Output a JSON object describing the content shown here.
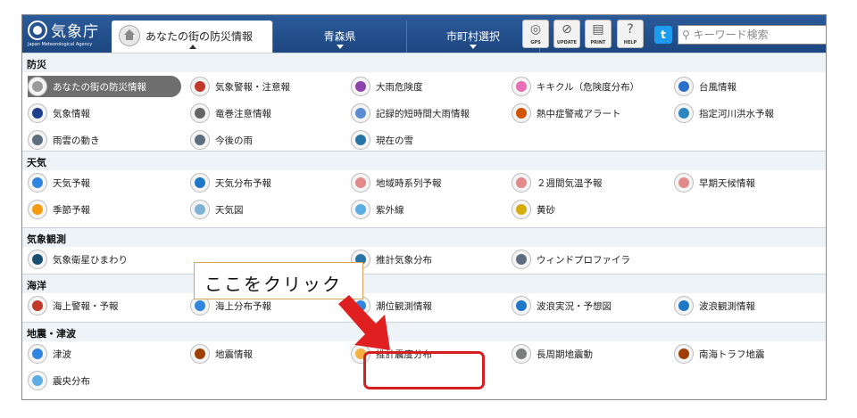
{
  "header": {
    "logo_text": "気象庁",
    "logo_sub": "Japan Meteorological Agency",
    "active_tab": "あなたの街の防災情報",
    "home_icon": "home-icon",
    "tabs": [
      "青森県",
      "市町村選択"
    ],
    "tools": [
      {
        "name": "gps",
        "caption": "GPS",
        "glyph": "◎"
      },
      {
        "name": "updates",
        "caption": "UPDATE",
        "glyph": "⊘"
      },
      {
        "name": "print",
        "caption": "PRINT",
        "glyph": "▤"
      },
      {
        "name": "help",
        "caption": "HELP",
        "glyph": "?"
      }
    ],
    "twitter_glyph": "t",
    "search_placeholder": "キーワード検索",
    "header_color": "#2c5b9a"
  },
  "sections": [
    {
      "title": "防災",
      "items": [
        {
          "label": "あなたの街の防災情報",
          "icon": "home-icon",
          "selected": true,
          "color": "#9a9a9a"
        },
        {
          "label": "気象警報・注意報",
          "icon": "warning-icon",
          "color": "#c0392b"
        },
        {
          "label": "大雨危険度",
          "icon": "heavy-rain-risk-icon",
          "color": "#8e44ad"
        },
        {
          "label": "キキクル（危険度分布）",
          "icon": "kikikuru-icon",
          "color": "#e86fb7"
        },
        {
          "label": "台風情報",
          "icon": "typhoon-icon",
          "color": "#2a6fc9"
        },
        {
          "label": "気象情報",
          "icon": "weather-info-icon",
          "color": "#1e3f8a"
        },
        {
          "label": "竜巻注意情報",
          "icon": "tornado-icon",
          "color": "#666666"
        },
        {
          "label": "記録的短時間大雨情報",
          "icon": "record-rain-icon",
          "color": "#5b8bd0"
        },
        {
          "label": "熱中症警戒アラート",
          "icon": "heatstroke-icon",
          "color": "#d35400"
        },
        {
          "label": "指定河川洪水予報",
          "icon": "river-flood-icon",
          "color": "#2e86c1"
        },
        {
          "label": "雨雲の動き",
          "icon": "rain-cloud-icon",
          "color": "#5d6d7e"
        },
        {
          "label": "今後の雨",
          "icon": "future-rain-icon",
          "color": "#5d6d7e"
        },
        {
          "label": "現在の雪",
          "icon": "snow-icon",
          "color": "#2874a6"
        }
      ]
    },
    {
      "title": "天気",
      "items": [
        {
          "label": "天気予報",
          "icon": "forecast-icon",
          "color": "#2e86de"
        },
        {
          "label": "天気分布予報",
          "icon": "weather-distribution-icon",
          "color": "#1f77c8"
        },
        {
          "label": "地域時系列予報",
          "icon": "regional-timeseries-icon",
          "color": "#e08a8a"
        },
        {
          "label": "２週間気温予報",
          "icon": "two-week-temp-icon",
          "color": "#e08a8a"
        },
        {
          "label": "早期天候情報",
          "icon": "early-weather-icon",
          "color": "#e08a8a"
        },
        {
          "label": "季節予報",
          "icon": "seasonal-icon",
          "color": "#f39c12"
        },
        {
          "label": "天気図",
          "icon": "weather-map-icon",
          "color": "#7fb3d5"
        },
        {
          "label": "紫外線",
          "icon": "uv-icon",
          "color": "#5dade2"
        },
        {
          "label": "黄砂",
          "icon": "yellow-sand-icon",
          "color": "#d4ac0d"
        }
      ]
    },
    {
      "title": "気象観測",
      "items": [
        {
          "label": "気象衛星ひまわり",
          "icon": "satellite-icon",
          "color": "#1b4f72"
        },
        {
          "label": "推計気象分布",
          "icon": "estimated-weather-icon",
          "color": "#2874a6"
        },
        {
          "label": "ウィンドプロファイラ",
          "icon": "wind-profiler-icon",
          "color": "#5d6d7e"
        }
      ]
    },
    {
      "title": "海洋",
      "items": [
        {
          "label": "海上警報・予報",
          "icon": "marine-warning-icon",
          "color": "#c0392b"
        },
        {
          "label": "海上分布予報",
          "icon": "marine-distribution-icon",
          "color": "#2e86de"
        },
        {
          "label": "潮位観測情報",
          "icon": "tide-icon",
          "color": "#2e86de"
        },
        {
          "label": "波浪実況・予想図",
          "icon": "wave-chart-icon",
          "color": "#1f77c8"
        },
        {
          "label": "波浪観測情報",
          "icon": "wave-obs-icon",
          "color": "#1f77c8"
        }
      ]
    },
    {
      "title": "地震・津波",
      "items": [
        {
          "label": "津波",
          "icon": "tsunami-icon",
          "color": "#2e86de"
        },
        {
          "label": "地震情報",
          "icon": "earthquake-icon",
          "color": "#a04000"
        },
        {
          "label": "推計震度分布",
          "icon": "estimated-intensity-icon",
          "color": "#f5b041"
        },
        {
          "label": "長周期地震動",
          "icon": "long-period-icon",
          "color": "#7b7d7d"
        },
        {
          "label": "南海トラフ地震",
          "icon": "nankai-trough-icon",
          "color": "#a04000"
        },
        {
          "label": "震央分布",
          "icon": "epicenter-icon",
          "color": "#5dade2"
        }
      ]
    }
  ],
  "annotation": {
    "callout_text": "ここをクリック",
    "arrow_color": "#e02020",
    "highlight_color": "#d62020"
  }
}
